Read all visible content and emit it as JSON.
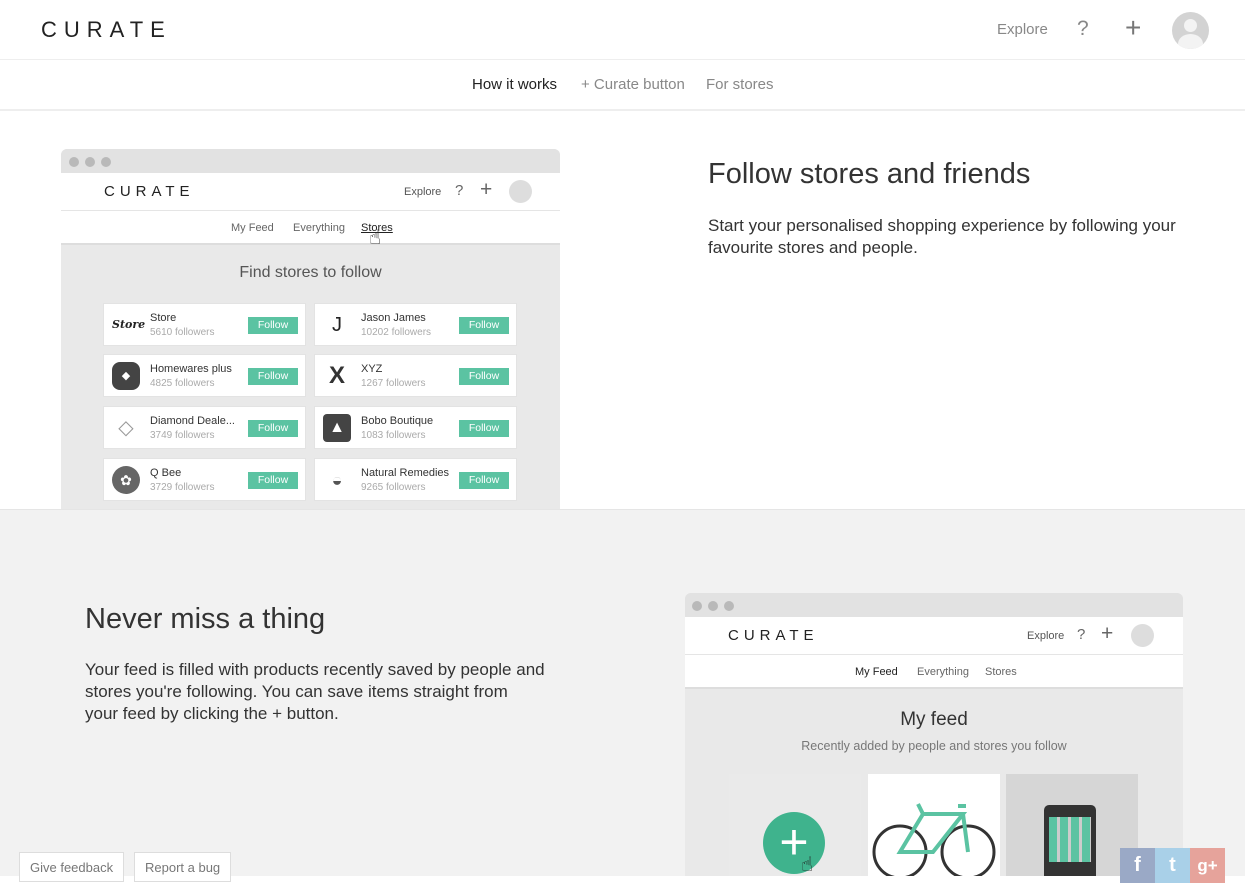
{
  "header": {
    "logo": "CURATE",
    "explore": "Explore",
    "help": "?",
    "plus": "+"
  },
  "subnav": {
    "how_it_works": "How it works",
    "curate_button": "+ Curate button",
    "for_stores": "For stores"
  },
  "section_follow": {
    "title": "Follow stores and friends",
    "description": "Start your personalised shopping experience by following your favourite stores and people.",
    "mock": {
      "logo": "CURATE",
      "explore": "Explore",
      "help": "?",
      "plus": "+",
      "nav": [
        "My Feed",
        "Everything",
        "Stores"
      ],
      "heading": "Find stores to follow",
      "follow_label": "Follow",
      "stores": [
        {
          "name": "Store",
          "followers": "5610 followers",
          "icon": "store-logo-icon"
        },
        {
          "name": "Jason James",
          "followers": "10202 followers",
          "icon": "jj-logo-icon"
        },
        {
          "name": "Homewares plus",
          "followers": "4825 followers",
          "icon": "homewares-logo-icon"
        },
        {
          "name": "XYZ",
          "followers": "1267 followers",
          "icon": "xyz-logo-icon"
        },
        {
          "name": "Diamond Deale...",
          "followers": "3749 followers",
          "icon": "diamond-icon"
        },
        {
          "name": "Bobo Boutique",
          "followers": "1083 followers",
          "icon": "bobo-logo-icon"
        },
        {
          "name": "Q Bee",
          "followers": "3729 followers",
          "icon": "bee-icon"
        },
        {
          "name": "Natural Remedies",
          "followers": "9265 followers",
          "icon": "mortar-icon"
        }
      ]
    }
  },
  "section_feed": {
    "title": "Never miss a thing",
    "description": "Your feed is filled with products recently saved by people and stores you're following. You can save items straight from your feed by clicking the + button.",
    "mock": {
      "logo": "CURATE",
      "explore": "Explore",
      "help": "?",
      "plus": "+",
      "nav": [
        "My Feed",
        "Everything",
        "Stores"
      ],
      "heading": "My feed",
      "subheading": "Recently added by people and stores you follow"
    }
  },
  "footer": {
    "give_feedback": "Give feedback",
    "report_bug": "Report a bug",
    "social": [
      "f",
      "t",
      "g+"
    ]
  },
  "colors": {
    "accent": "#5bc3a2",
    "facebook": "#9aa9c6",
    "twitter": "#a9d0e8",
    "google": "#e6a39b"
  }
}
